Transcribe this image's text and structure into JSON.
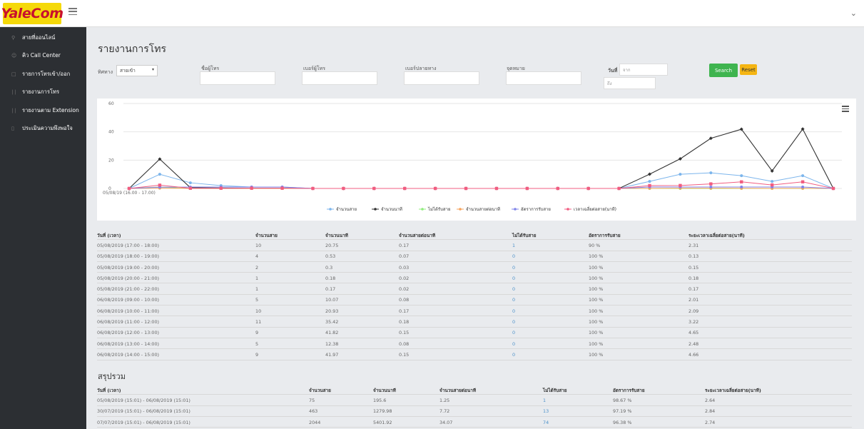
{
  "brand": {
    "logo_text": "YaleCom"
  },
  "sidebar": {
    "items": [
      {
        "label": "สายที่ออนไลน์",
        "icon": "pin-icon"
      },
      {
        "label": "คิว Call Center",
        "icon": "users-icon"
      },
      {
        "label": "รายการโทรเข้า/ออก",
        "icon": "document-icon"
      },
      {
        "label": "รายงานการโทร",
        "icon": "bar-chart-icon"
      },
      {
        "label": "รายงานตาม Extension",
        "icon": "bar-chart-icon"
      },
      {
        "label": "ประเมินความพึงพอใจ",
        "icon": "bookmark-icon"
      }
    ]
  },
  "page": {
    "title": "รายงานการโทร"
  },
  "filters": {
    "direction_label": "ทิศทาง",
    "direction_value": "สายเข้า",
    "caller_label": "ชื่อผู้โทร",
    "caller_number_label": "เบอร์ผู้โทร",
    "dest_number_label": "เบอร์ปลายทาง",
    "purpose_label": "จุดหมาย",
    "date_label": "วันที่",
    "date_from_placeholder": "จาก",
    "date_to_placeholder": "ถึง",
    "search_label": "Search",
    "reset_label": "Reset"
  },
  "chart_data": {
    "type": "line",
    "title": "",
    "yticks": [
      "0",
      "20",
      "40",
      "60"
    ],
    "ylim": [
      0,
      60
    ],
    "x_first_label": "05/08/19 (16.00 - 17.00)",
    "colors": [
      "#7cb5ec",
      "#333333",
      "#90ed7d",
      "#f7a35c",
      "#8085e9",
      "#f15c80"
    ],
    "series": [
      {
        "name": "จำนวนสาย",
        "values": [
          0,
          10,
          4,
          2,
          1,
          1,
          0,
          0,
          0,
          0,
          0,
          0,
          0,
          0,
          0,
          0,
          0,
          5,
          10,
          11,
          9,
          5,
          9,
          0
        ]
      },
      {
        "name": "จำนวนนาที",
        "values": [
          0,
          20.75,
          0.53,
          0.3,
          0.18,
          0.17,
          0,
          0,
          0,
          0,
          0,
          0,
          0,
          0,
          0,
          0,
          0,
          10.07,
          20.93,
          35.42,
          41.82,
          12.38,
          41.97,
          0
        ]
      },
      {
        "name": "ไม่ได้รับสาย",
        "values": [
          0,
          1,
          0,
          0,
          0,
          0,
          0,
          0,
          0,
          0,
          0,
          0,
          0,
          0,
          0,
          0,
          0,
          0,
          0,
          0,
          0,
          0,
          0,
          0
        ]
      },
      {
        "name": "จำนวนสายต่อนาที",
        "values": [
          0,
          0.17,
          0.07,
          0.03,
          0.02,
          0.02,
          0,
          0,
          0,
          0,
          0,
          0,
          0,
          0,
          0,
          0,
          0,
          0.08,
          0.17,
          0.18,
          0.15,
          0.08,
          0.15,
          0
        ]
      },
      {
        "name": "อัตราการรับสาย",
        "values": [
          0,
          0.9,
          1,
          1,
          1,
          1,
          0,
          0,
          0,
          0,
          0,
          0,
          0,
          0,
          0,
          0,
          0,
          1,
          1,
          1,
          1,
          1,
          1,
          0
        ]
      },
      {
        "name": "เวลาเฉลี่ยต่อสาย(นาที)",
        "values": [
          0,
          2.31,
          0.13,
          0.15,
          0.18,
          0.17,
          0,
          0,
          0,
          0,
          0,
          0,
          0,
          0,
          0,
          0,
          0,
          2.01,
          2.09,
          3.22,
          4.65,
          2.48,
          4.66,
          0
        ]
      }
    ]
  },
  "detail_table": {
    "headers": [
      "วันที่ (เวลา)",
      "จำนวนสาย",
      "จำนวนนาที",
      "จำนวนสายต่อนาที",
      "ไม่ได้รับสาย",
      "อัตราการรับสาย",
      "ระยะเวลาเฉลี่ยต่อสาย(นาที)"
    ],
    "rows": [
      [
        "05/08/2019 (17:00 - 18:00)",
        "10",
        "20.75",
        "0.17",
        "1",
        "90 %",
        "2.31"
      ],
      [
        "05/08/2019 (18:00 - 19:00)",
        "4",
        "0.53",
        "0.07",
        "0",
        "100 %",
        "0.13"
      ],
      [
        "05/08/2019 (19:00 - 20:00)",
        "2",
        "0.3",
        "0.03",
        "0",
        "100 %",
        "0.15"
      ],
      [
        "05/08/2019 (20:00 - 21:00)",
        "1",
        "0.18",
        "0.02",
        "0",
        "100 %",
        "0.18"
      ],
      [
        "05/08/2019 (21:00 - 22:00)",
        "1",
        "0.17",
        "0.02",
        "0",
        "100 %",
        "0.17"
      ],
      [
        "06/08/2019 (09:00 - 10:00)",
        "5",
        "10.07",
        "0.08",
        "0",
        "100 %",
        "2.01"
      ],
      [
        "06/08/2019 (10:00 - 11:00)",
        "10",
        "20.93",
        "0.17",
        "0",
        "100 %",
        "2.09"
      ],
      [
        "06/08/2019 (11:00 - 12:00)",
        "11",
        "35.42",
        "0.18",
        "0",
        "100 %",
        "3.22"
      ],
      [
        "06/08/2019 (12:00 - 13:00)",
        "9",
        "41.82",
        "0.15",
        "0",
        "100 %",
        "4.65"
      ],
      [
        "06/08/2019 (13:00 - 14:00)",
        "5",
        "12.38",
        "0.08",
        "0",
        "100 %",
        "2.48"
      ],
      [
        "06/08/2019 (14:00 - 15:00)",
        "9",
        "41.97",
        "0.15",
        "0",
        "100 %",
        "4.66"
      ]
    ]
  },
  "summary": {
    "title": "สรุปรวม",
    "headers": [
      "วันที่ (เวลา)",
      "จำนวนสาย",
      "จำนวนนาที",
      "จำนวนสายต่อนาที",
      "ไม่ได้รับสาย",
      "อัตราการรับสาย",
      "ระยะเวลาเฉลี่ยต่อสาย(นาที)"
    ],
    "rows": [
      [
        "05/08/2019 (15:01) - 06/08/2019 (15:01)",
        "75",
        "195.6",
        "1.25",
        "1",
        "98.67 %",
        "2.64"
      ],
      [
        "30/07/2019 (15:01) - 06/08/2019 (15:01)",
        "463",
        "1279.98",
        "7.72",
        "13",
        "97.19 %",
        "2.84"
      ],
      [
        "07/07/2019 (15:01) - 06/08/2019 (15:01)",
        "2044",
        "5401.92",
        "34.07",
        "74",
        "96.38 %",
        "2.74"
      ]
    ]
  }
}
